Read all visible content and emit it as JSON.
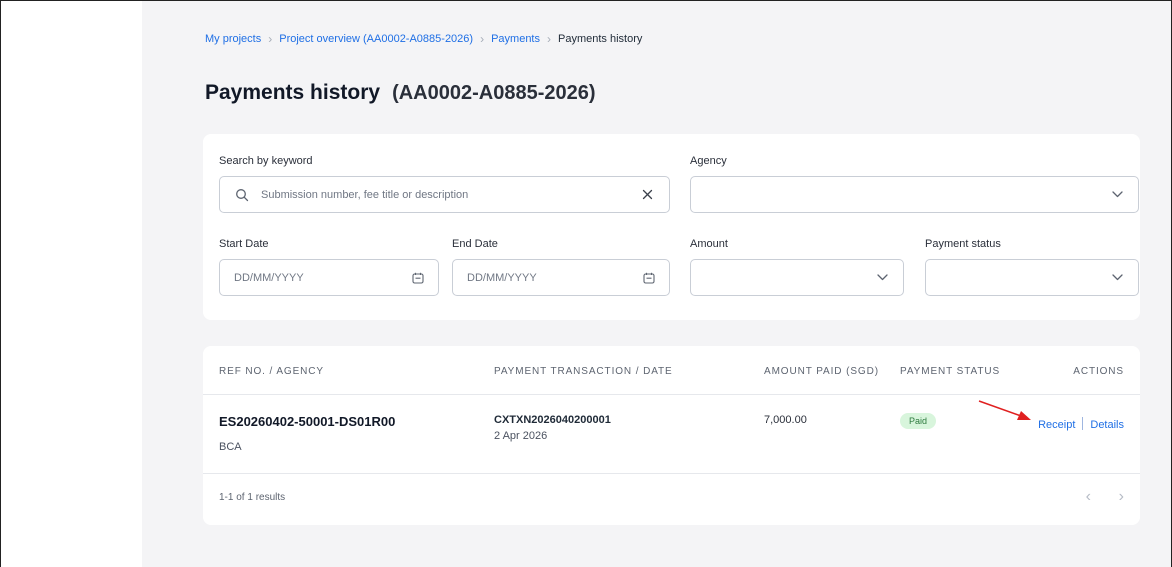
{
  "breadcrumb": {
    "items": [
      "My projects",
      "Project overview (AA0002-A0885-2026)",
      "Payments"
    ],
    "current": "Payments history"
  },
  "page": {
    "title": "Payments history",
    "subtitle": "(AA0002-A0885-2026)"
  },
  "filters": {
    "search": {
      "label": "Search by keyword",
      "placeholder": "Submission number, fee title or description",
      "value": ""
    },
    "agency": {
      "label": "Agency",
      "value": ""
    },
    "start_date": {
      "label": "Start Date",
      "placeholder": "DD/MM/YYYY"
    },
    "end_date": {
      "label": "End Date",
      "placeholder": "DD/MM/YYYY"
    },
    "amount": {
      "label": "Amount",
      "value": ""
    },
    "payment_status": {
      "label": "Payment status",
      "value": ""
    }
  },
  "table": {
    "columns": [
      "REF NO. / AGENCY",
      "PAYMENT TRANSACTION / DATE",
      "AMOUNT PAID (SGD)",
      "PAYMENT STATUS",
      "ACTIONS"
    ],
    "rows": [
      {
        "ref": "ES20260402-50001-DS01R00",
        "agency": "BCA",
        "transaction": "CXTXN2026040200001",
        "date": "2 Apr 2026",
        "amount": "7,000.00",
        "status": "Paid",
        "actions": [
          "Receipt",
          "Details"
        ]
      }
    ],
    "results_text": "1-1 of 1 results"
  },
  "icons": {
    "search": "search-icon",
    "clear": "close-icon",
    "calendar": "calendar-icon",
    "dropdown": "chevron-down-icon",
    "prev": "chevron-left-icon",
    "next": "chevron-right-icon",
    "annotation": "red-arrow-annotation"
  },
  "colors": {
    "link": "#1f6fe5",
    "page_bg": "#f4f4f6",
    "paid_badge_bg": "#d8f5dc",
    "paid_badge_text": "#2d7a3e",
    "annotation": "#e02020"
  }
}
